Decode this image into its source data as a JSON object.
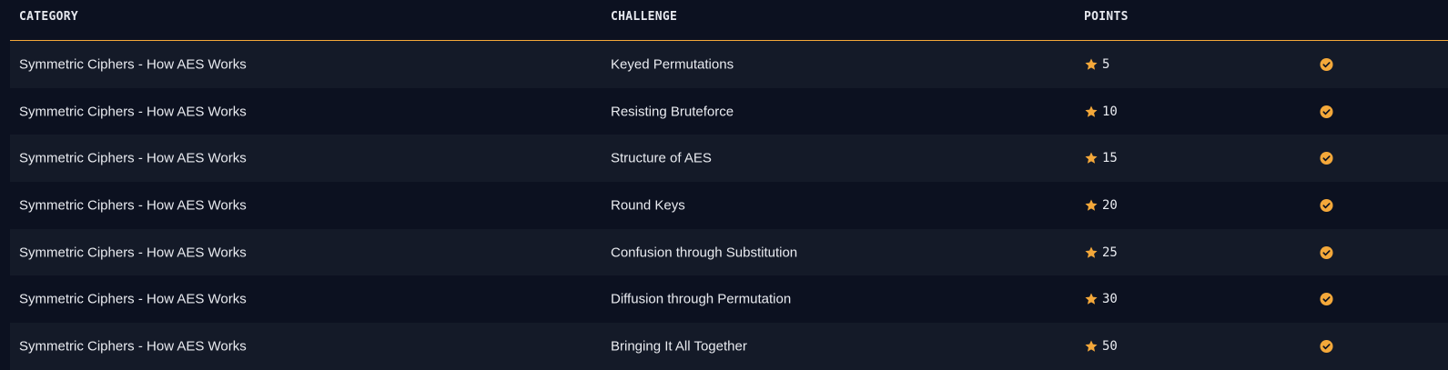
{
  "columns": {
    "category": "CATEGORY",
    "challenge": "CHALLENGE",
    "points": "POINTS"
  },
  "colors": {
    "accent": "#f4a83a",
    "bg": "#0c1120",
    "row_alt": "#141a28"
  },
  "icons": {
    "points": "star-icon",
    "solved": "check-circle-icon"
  },
  "rows": [
    {
      "category": "Symmetric Ciphers - How AES Works",
      "challenge": "Keyed Permutations",
      "points": "5",
      "solved": true
    },
    {
      "category": "Symmetric Ciphers - How AES Works",
      "challenge": "Resisting Bruteforce",
      "points": "10",
      "solved": true
    },
    {
      "category": "Symmetric Ciphers - How AES Works",
      "challenge": "Structure of AES",
      "points": "15",
      "solved": true
    },
    {
      "category": "Symmetric Ciphers - How AES Works",
      "challenge": "Round Keys",
      "points": "20",
      "solved": true
    },
    {
      "category": "Symmetric Ciphers - How AES Works",
      "challenge": "Confusion through Substitution",
      "points": "25",
      "solved": true
    },
    {
      "category": "Symmetric Ciphers - How AES Works",
      "challenge": "Diffusion through Permutation",
      "points": "30",
      "solved": true
    },
    {
      "category": "Symmetric Ciphers - How AES Works",
      "challenge": "Bringing It All Together",
      "points": "50",
      "solved": true
    }
  ]
}
